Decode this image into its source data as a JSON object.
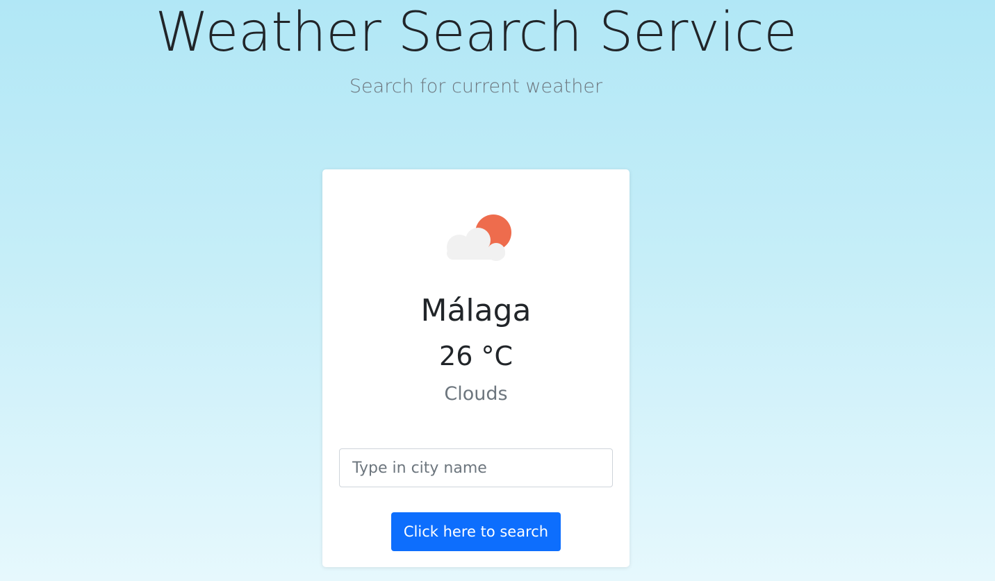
{
  "header": {
    "title": "Weather Search Service",
    "subtitle": "Search for current weather"
  },
  "weather": {
    "icon": "cloud-sun-icon",
    "city": "Málaga",
    "temperature": "26 °C",
    "condition": "Clouds"
  },
  "search": {
    "placeholder": "Type in city name",
    "value": "",
    "button_label": "Click here to search"
  },
  "colors": {
    "background_top": "#b1e7f6",
    "background_bottom": "#e6f8fd",
    "primary_button": "#0d6efd",
    "sun": "#ee6c4d",
    "cloud": "#f1f1f1"
  }
}
